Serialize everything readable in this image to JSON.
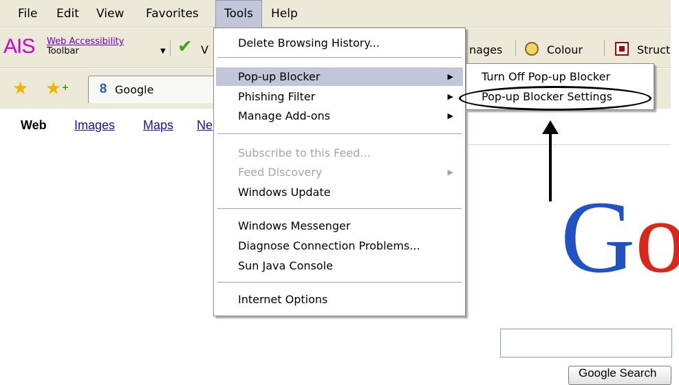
{
  "menubar": {
    "items": [
      "File",
      "Edit",
      "View",
      "Favorites",
      "Tools",
      "Help"
    ]
  },
  "toolbar1": {
    "ais_logo": "AIS",
    "ais_line1": "Web Accessibility",
    "ais_line2": "Toolbar",
    "v_partial": "V",
    "images_partial": "nages",
    "colour": "Colour",
    "struct_partial": "Struct"
  },
  "toolbar2": {
    "tab_label": "Google",
    "tab_icon": "8"
  },
  "google": {
    "nav": [
      "Web",
      "Images",
      "Maps",
      "Ne"
    ],
    "logo_partial": "Go",
    "search_button": "Google Search",
    "search_value": ""
  },
  "tools_menu": {
    "items": [
      {
        "label": "Delete Browsing History...",
        "has_submenu": false,
        "disabled": false
      },
      {
        "label": "Pop-up Blocker",
        "has_submenu": true,
        "disabled": false,
        "highlighted": true
      },
      {
        "label": "Phishing Filter",
        "has_submenu": true,
        "disabled": false
      },
      {
        "label": "Manage Add-ons",
        "has_submenu": true,
        "disabled": false
      },
      {
        "label": "Subscribe to this Feed...",
        "has_submenu": false,
        "disabled": true
      },
      {
        "label": "Feed Discovery",
        "has_submenu": true,
        "disabled": true
      },
      {
        "label": "Windows Update",
        "has_submenu": false,
        "disabled": false
      },
      {
        "label": "Windows Messenger",
        "has_submenu": false,
        "disabled": false
      },
      {
        "label": "Diagnose Connection Problems...",
        "has_submenu": false,
        "disabled": false
      },
      {
        "label": "Sun Java Console",
        "has_submenu": false,
        "disabled": false
      },
      {
        "label": "Internet Options",
        "has_submenu": false,
        "disabled": false
      }
    ]
  },
  "submenu": {
    "items": [
      "Turn Off Pop-up Blocker",
      "Pop-up Blocker Settings"
    ]
  },
  "colors": {
    "menu_highlight": "#c1c6d9",
    "chrome_bg": "#ece9d8",
    "link_blue": "#1a0dab",
    "ais_magenta": "#d200c8"
  }
}
